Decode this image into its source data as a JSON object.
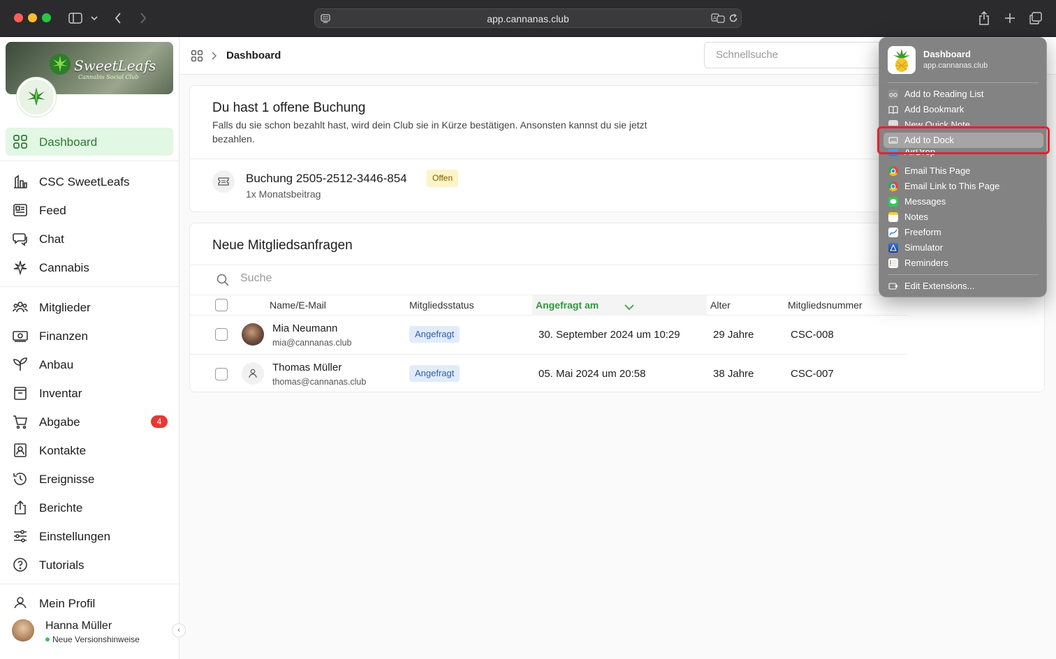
{
  "browser": {
    "url": "app.cannanas.club"
  },
  "brand": {
    "name": "SweetLeafs",
    "tagline": "Cannabis Social Club"
  },
  "header": {
    "breadcrumb_title": "Dashboard",
    "search_placeholder": "Schnellsuche"
  },
  "sidebar": {
    "items": [
      {
        "label": "Dashboard",
        "icon": "grid-icon",
        "active": true
      },
      {
        "label": "CSC SweetLeafs",
        "icon": "chart-icon"
      },
      {
        "label": "Feed",
        "icon": "newspaper-icon"
      },
      {
        "label": "Chat",
        "icon": "chat-icon"
      },
      {
        "label": "Cannabis",
        "icon": "cannabis-leaf-icon"
      },
      {
        "label": "Mitglieder",
        "icon": "users-icon"
      },
      {
        "label": "Finanzen",
        "icon": "money-icon"
      },
      {
        "label": "Anbau",
        "icon": "sprout-icon"
      },
      {
        "label": "Inventar",
        "icon": "archive-icon"
      },
      {
        "label": "Abgabe",
        "icon": "cart-icon",
        "badge": "4"
      },
      {
        "label": "Kontakte",
        "icon": "contact-icon"
      },
      {
        "label": "Ereignisse",
        "icon": "history-icon"
      },
      {
        "label": "Berichte",
        "icon": "share-icon"
      },
      {
        "label": "Einstellungen",
        "icon": "sliders-icon"
      },
      {
        "label": "Tutorials",
        "icon": "help-icon"
      },
      {
        "label": "Mein Profil",
        "icon": "user-icon"
      }
    ],
    "user": {
      "name": "Hanna Müller",
      "note": "Neue Versionshinweise"
    }
  },
  "booking_card": {
    "title": "Du hast 1 offene Buchung",
    "text": "Falls du sie schon bezahlt hast, wird dein Club sie in Kürze bestätigen. Ansonsten kannst du sie jetzt bezahlen.",
    "booking_title": "Buchung 2505-2512-3446-854",
    "booking_sub": "1x Monatsbeitrag",
    "status": "Offen"
  },
  "requests_card": {
    "title": "Neue Mitgliedsanfragen",
    "search_placeholder": "Suche",
    "columns": [
      "Name/E-Mail",
      "Mitgliedsstatus",
      "Angefragt am",
      "Alter",
      "Mitgliedsnummer"
    ],
    "rows": [
      {
        "name": "Mia Neumann",
        "email": "mia@cannanas.club",
        "status": "Angefragt",
        "date": "30. September 2024 um 10:29",
        "age": "29 Jahre",
        "number": "CSC-008"
      },
      {
        "name": "Thomas Müller",
        "email": "thomas@cannanas.club",
        "status": "Angefragt",
        "date": "05. Mai 2024 um 20:58",
        "age": "38 Jahre",
        "number": "CSC-007"
      }
    ]
  },
  "share_menu": {
    "title": "Dashboard",
    "url": "app.cannanas.club",
    "items": [
      {
        "label": "Add to Reading List",
        "icon": "glasses-icon"
      },
      {
        "label": "Add Bookmark",
        "icon": "book-icon"
      },
      {
        "label": "New Quick Note",
        "icon": "note-icon"
      },
      {
        "label": "Add to Dock",
        "icon": "dock-icon",
        "highlighted": true
      },
      {
        "label": "AirDrop",
        "icon": "airdrop-icon"
      },
      {
        "label": "Email This Page",
        "icon": "chrome-icon"
      },
      {
        "label": "Email Link to This Page",
        "icon": "chrome-icon"
      },
      {
        "label": "Messages",
        "icon": "messages-icon"
      },
      {
        "label": "Notes",
        "icon": "notes-icon"
      },
      {
        "label": "Freeform",
        "icon": "freeform-icon"
      },
      {
        "label": "Simulator",
        "icon": "simulator-icon"
      },
      {
        "label": "Reminders",
        "icon": "reminders-icon"
      }
    ],
    "edit_label": "Edit Extensions..."
  },
  "colors": {
    "accent_green": "#2e9a3c",
    "active_bg": "#e2f7e4",
    "badge_red": "#e53935",
    "highlight_red": "#e8202e"
  }
}
